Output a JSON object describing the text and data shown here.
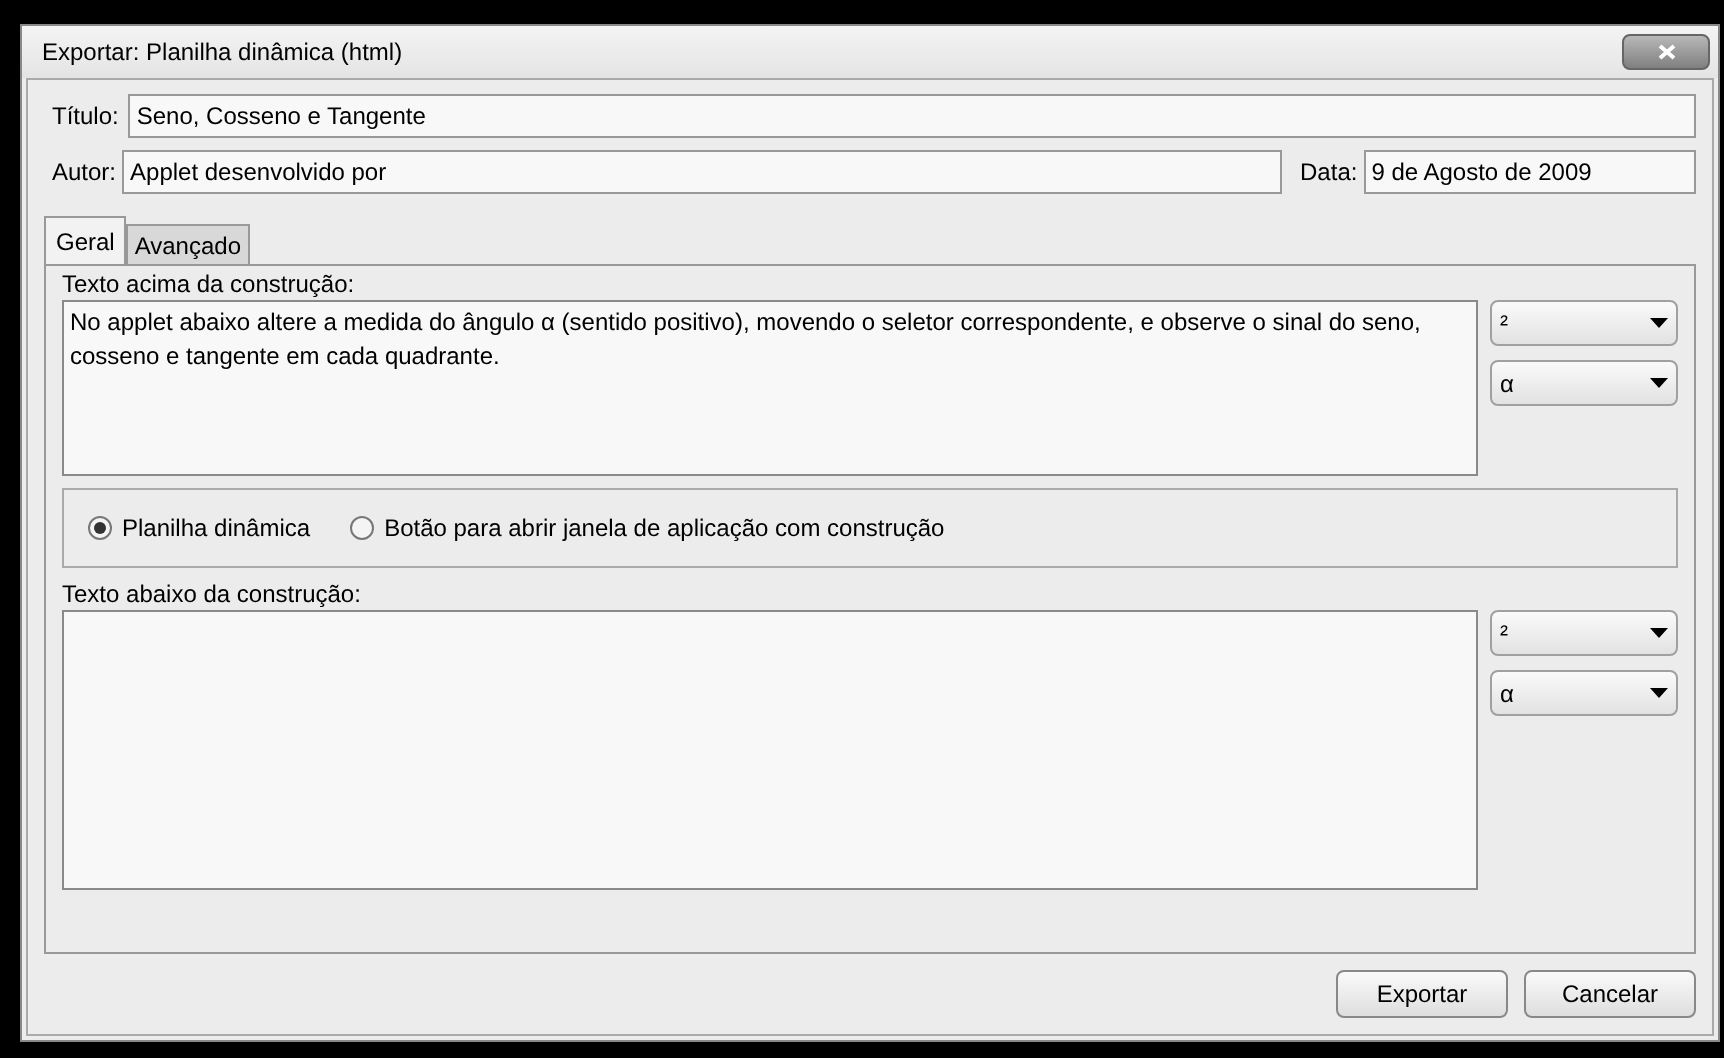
{
  "window": {
    "title": "Exportar: Planilha dinâmica (html)"
  },
  "fields": [
    {
      "label": "Título:",
      "value": "Seno, Cosseno e Tangente"
    },
    {
      "label": "Autor:",
      "value": "Applet desenvolvido por"
    },
    {
      "label": "Data:",
      "value": "9 de Agosto de 2009"
    }
  ],
  "tabs": [
    {
      "label": "Geral",
      "selected": true
    },
    {
      "label": "Avançado",
      "selected": false
    }
  ],
  "text_above": {
    "label": "Texto acima da construção:",
    "value": "No applet abaixo altere a medida do ângulo α (sentido positivo), movendo o seletor correspondente, e observe o sinal do seno, cosseno e tangente em cada quadrante.",
    "dropdowns": [
      "²",
      "α"
    ]
  },
  "mode_options": [
    {
      "label": "Planilha dinâmica",
      "selected": true
    },
    {
      "label": "Botão para abrir janela de aplicação com construção",
      "selected": false
    }
  ],
  "text_below": {
    "label": "Texto abaixo da construção:",
    "dropdowns": [
      "²",
      "α"
    ]
  },
  "buttons": [
    "Exportar",
    "Cancelar"
  ]
}
